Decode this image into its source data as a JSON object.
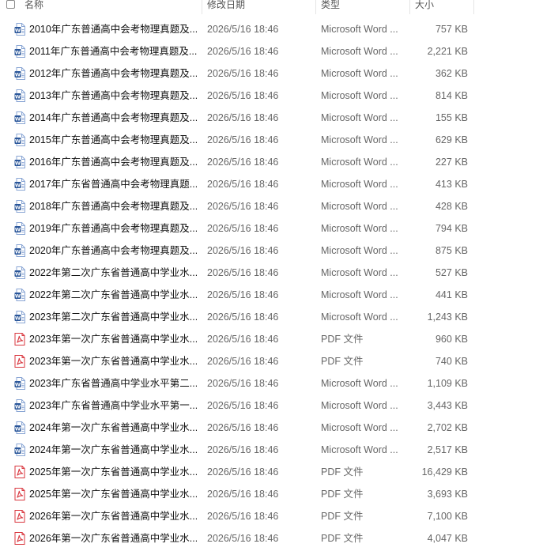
{
  "colors": {
    "word": "#2b579a",
    "pdf": "#d9363e",
    "text": "#1f1f1f",
    "muted": "#666666"
  },
  "columns": {
    "name": "名称",
    "modified": "修改日期",
    "type": "类型",
    "size": "大小"
  },
  "files": [
    {
      "name": "2010年广东普通高中会考物理真题及...",
      "modified": "2026/5/16 18:46",
      "type": "Microsoft Word ...",
      "size": "757 KB",
      "icon": "word-doc-icon"
    },
    {
      "name": "2011年广东普通高中会考物理真题及...",
      "modified": "2026/5/16 18:46",
      "type": "Microsoft Word ...",
      "size": "2,221 KB",
      "icon": "word-doc-icon"
    },
    {
      "name": "2012年广东普通高中会考物理真题及...",
      "modified": "2026/5/16 18:46",
      "type": "Microsoft Word ...",
      "size": "362 KB",
      "icon": "word-doc-icon"
    },
    {
      "name": "2013年广东普通高中会考物理真题及...",
      "modified": "2026/5/16 18:46",
      "type": "Microsoft Word ...",
      "size": "814 KB",
      "icon": "word-doc-icon"
    },
    {
      "name": "2014年广东普通高中会考物理真题及...",
      "modified": "2026/5/16 18:46",
      "type": "Microsoft Word ...",
      "size": "155 KB",
      "icon": "word-doc-icon"
    },
    {
      "name": "2015年广东普通高中会考物理真题及...",
      "modified": "2026/5/16 18:46",
      "type": "Microsoft Word ...",
      "size": "629 KB",
      "icon": "word-doc-icon"
    },
    {
      "name": "2016年广东普通高中会考物理真题及...",
      "modified": "2026/5/16 18:46",
      "type": "Microsoft Word ...",
      "size": "227 KB",
      "icon": "word-doc-icon"
    },
    {
      "name": "2017年广东省普通高中会考物理真题...",
      "modified": "2026/5/16 18:46",
      "type": "Microsoft Word ...",
      "size": "413 KB",
      "icon": "word-doc-icon"
    },
    {
      "name": "2018年广东普通高中会考物理真题及...",
      "modified": "2026/5/16 18:46",
      "type": "Microsoft Word ...",
      "size": "428 KB",
      "icon": "word-doc-icon"
    },
    {
      "name": "2019年广东普通高中会考物理真题及...",
      "modified": "2026/5/16 18:46",
      "type": "Microsoft Word ...",
      "size": "794 KB",
      "icon": "word-doc-icon"
    },
    {
      "name": "2020年广东普通高中会考物理真题及...",
      "modified": "2026/5/16 18:46",
      "type": "Microsoft Word ...",
      "size": "875 KB",
      "icon": "word-doc-icon"
    },
    {
      "name": "2022年第二次广东省普通高中学业水...",
      "modified": "2026/5/16 18:46",
      "type": "Microsoft Word ...",
      "size": "527 KB",
      "icon": "word-doc-icon"
    },
    {
      "name": "2022年第二次广东省普通高中学业水...",
      "modified": "2026/5/16 18:46",
      "type": "Microsoft Word ...",
      "size": "441 KB",
      "icon": "word-doc-icon"
    },
    {
      "name": "2023年第二次广东省普通高中学业水...",
      "modified": "2026/5/16 18:46",
      "type": "Microsoft Word ...",
      "size": "1,243 KB",
      "icon": "word-doc-icon"
    },
    {
      "name": "2023年第一次广东省普通高中学业水...",
      "modified": "2026/5/16 18:46",
      "type": "PDF 文件",
      "size": "960 KB",
      "icon": "pdf-icon"
    },
    {
      "name": "2023年第一次广东省普通高中学业水...",
      "modified": "2026/5/16 18:46",
      "type": "PDF 文件",
      "size": "740 KB",
      "icon": "pdf-icon"
    },
    {
      "name": "2023年广东省普通高中学业水平第二...",
      "modified": "2026/5/16 18:46",
      "type": "Microsoft Word ...",
      "size": "1,109 KB",
      "icon": "word-doc-icon"
    },
    {
      "name": "2023年广东省普通高中学业水平第一...",
      "modified": "2026/5/16 18:46",
      "type": "Microsoft Word ...",
      "size": "3,443 KB",
      "icon": "word-doc-icon"
    },
    {
      "name": "2024年第一次广东省普通高中学业水...",
      "modified": "2026/5/16 18:46",
      "type": "Microsoft Word ...",
      "size": "2,702 KB",
      "icon": "word-doc-icon"
    },
    {
      "name": "2024年第一次广东省普通高中学业水...",
      "modified": "2026/5/16 18:46",
      "type": "Microsoft Word ...",
      "size": "2,517 KB",
      "icon": "word-doc-icon"
    },
    {
      "name": "2025年第一次广东省普通高中学业水...",
      "modified": "2026/5/16 18:46",
      "type": "PDF 文件",
      "size": "16,429 KB",
      "icon": "pdf-icon"
    },
    {
      "name": "2025年第一次广东省普通高中学业水...",
      "modified": "2026/5/16 18:46",
      "type": "PDF 文件",
      "size": "3,693 KB",
      "icon": "pdf-icon"
    },
    {
      "name": "2026年第一次广东省普通高中学业水...",
      "modified": "2026/5/16 18:46",
      "type": "PDF 文件",
      "size": "7,100 KB",
      "icon": "pdf-icon"
    },
    {
      "name": "2026年第一次广东省普通高中学业水...",
      "modified": "2026/5/16 18:46",
      "type": "PDF 文件",
      "size": "4,047 KB",
      "icon": "pdf-icon"
    }
  ]
}
